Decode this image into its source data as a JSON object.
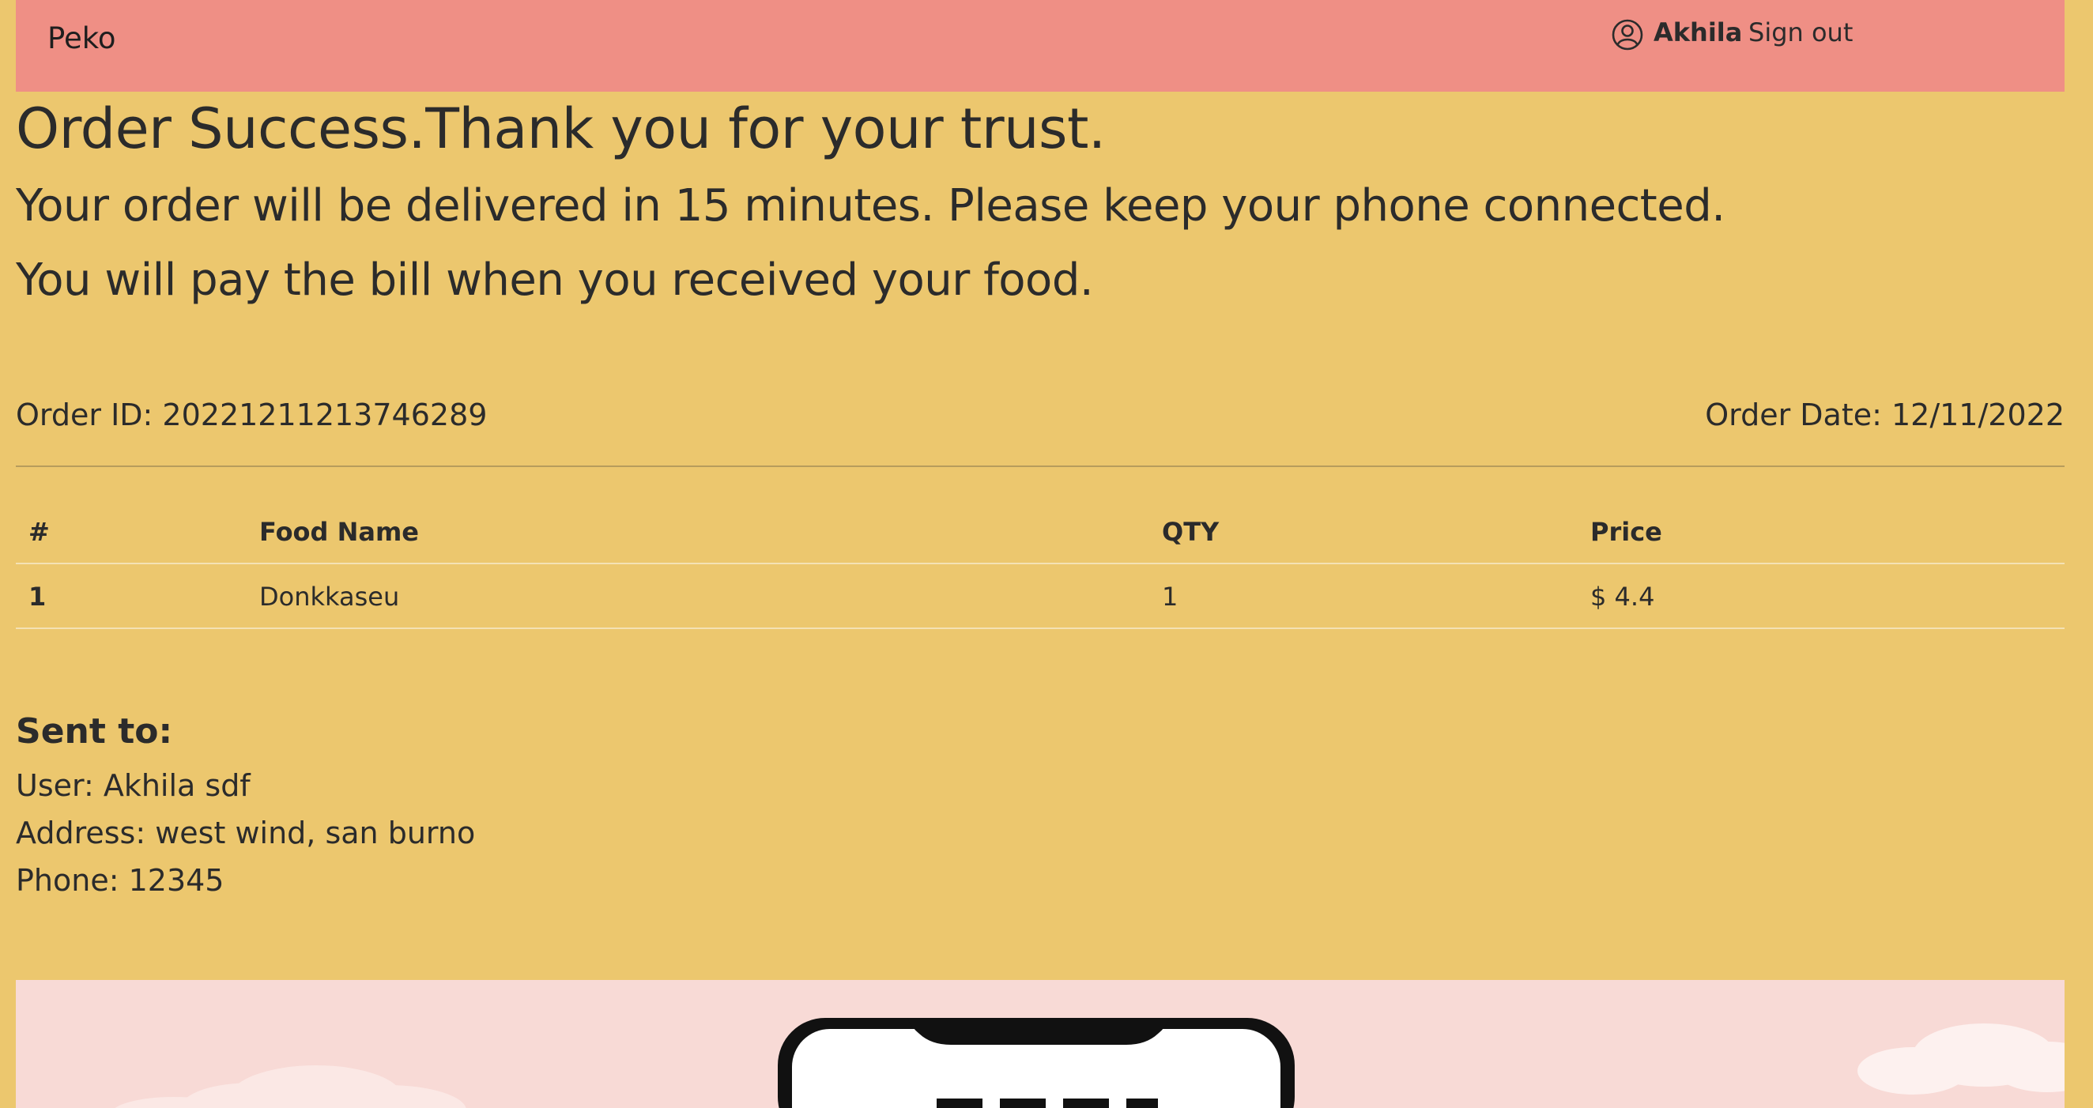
{
  "navbar": {
    "brand": "Peko",
    "username": "Akhila",
    "sign_out": "Sign out"
  },
  "headline": {
    "title": "Order Success.Thank you for your trust.",
    "line1": "Your order will be delivered in 15 minutes. Please keep your phone connected.",
    "line2": "You will pay the bill when you received your food."
  },
  "order": {
    "id_text": "Order ID: 20221211213746289",
    "date_text": "Order Date: 12/11/2022"
  },
  "table": {
    "headers": [
      "#",
      "Food Name",
      "QTY",
      "Price"
    ],
    "rows": [
      [
        "1",
        "Donkkaseu",
        "1",
        "$ 4.4"
      ]
    ]
  },
  "sent_to": {
    "heading": "Sent to:",
    "user": "User: Akhila sdf",
    "address": "Address: west wind, san burno",
    "phone": "Phone: 12345"
  },
  "icons": {
    "user": "user-circle-icon"
  },
  "colors": {
    "navbar": "#ef8f85",
    "background": "#ecc76e",
    "banner": "#f8dad6"
  }
}
